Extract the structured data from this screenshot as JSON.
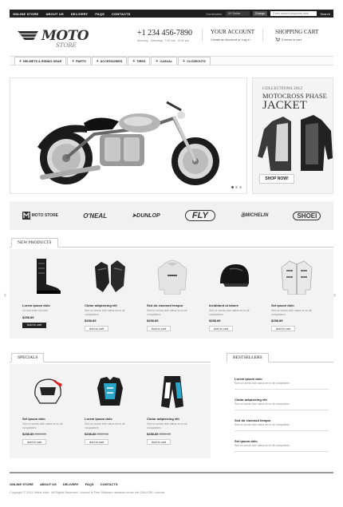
{
  "topbar": {
    "nav": [
      "ONLINE STORE",
      "ABOUT US",
      "DELIVERY",
      "FAQS",
      "CONTACTS"
    ],
    "currencies_label": "Currencies:",
    "currency_value": "US Dollar",
    "change_label": "Change",
    "search_placeholder": "Enter search keywords here",
    "search_label": "Search"
  },
  "header": {
    "logo_main": "MOTO",
    "logo_sub": "STORE",
    "phone": "+1 234 456-7890",
    "hours": "Monday - Saturday: 7:00 am - 6:00 pm",
    "account_title": "YOUR ACCOUNT",
    "account_create": "Create an Account",
    "account_or": "or",
    "account_login": "Log in",
    "cart_title": "SHOPPING CART",
    "cart_status": "0 items in cart"
  },
  "menu": [
    "HELMETS & RIDING GEAR",
    "PARTS",
    "ACCESSORIES",
    "TIRES",
    "CASUAL",
    "CLOSEOUTS"
  ],
  "promo": {
    "collection": "COLLECTIONS 2012",
    "title": "MOTOCROSS PHASE",
    "subtitle": "JACKET",
    "button": "SHOP NOW!"
  },
  "brands": [
    "MOTO STORE",
    "O'NEAL",
    "DUNLOP",
    "FLY",
    "MICHELIN",
    "SHOEI"
  ],
  "new_products": {
    "title": "NEW PRODUCTS",
    "items": [
      {
        "name": "Lorem ipsum dolo",
        "desc": "Ut wisi enim ad mini",
        "price": "$258.89",
        "button": "Add to cart",
        "dark": true,
        "icon": "boots-icon"
      },
      {
        "name": "Clotur adipisicing elit",
        "desc": "Sed ut omnis iste natus error sit voluptatem",
        "price": "$258.89",
        "button": "Add to cart",
        "dark": false,
        "icon": "gloves-icon"
      },
      {
        "name": "Sed do eiusmod tempor",
        "desc": "Sed ut omnis iste natus error sit voluptatem",
        "price": "$258.89",
        "button": "Add to cart",
        "dark": false,
        "icon": "hoodie-icon"
      },
      {
        "name": "Incididunt ut labore",
        "desc": "Sed ut omnis iste natus error sit voluptatem",
        "price": "$258.89",
        "button": "Add to cart",
        "dark": false,
        "icon": "helmet-icon"
      },
      {
        "name": "Set ipsum dolo",
        "desc": "Sed ut omnis iste natus error sit voluptatem",
        "price": "$258.89",
        "button": "Add to cart",
        "dark": false,
        "icon": "jacket-icon"
      }
    ]
  },
  "specials": {
    "title": "SPECIALS",
    "items": [
      {
        "name": "Set ipsum dolo",
        "desc": "Sed ut omnis iste natus error sit voluptatem",
        "price": "$258.89",
        "old_price": "$335.88",
        "button": "Add to cart",
        "icon": "mx-helmet-icon"
      },
      {
        "name": "Lorem ipsum dolo",
        "desc": "Sed ut omnis iste natus error sit voluptatem",
        "price": "$258.89",
        "old_price": "$335.88",
        "button": "Add to cart",
        "icon": "chest-protector-icon"
      },
      {
        "name": "Clotur adipisicing elit",
        "desc": "Sed ut omnis iste natus error sit voluptatem",
        "price": "$258.89",
        "old_price": "$335.88",
        "button": "Add to cart",
        "icon": "mx-pants-icon"
      }
    ]
  },
  "bestsellers": {
    "title": "BESTSELLERS",
    "items": [
      {
        "name": "Lorem ipsum dolo",
        "desc": "Sed ut omnis iste natus error sit voluptatem"
      },
      {
        "name": "Clotur adipisicing elit",
        "desc": "Sed ut omnis iste natus error sit voluptatem"
      },
      {
        "name": "Sed do eiusmod tempor",
        "desc": "Sed ut omnis iste natus error sit voluptatem"
      },
      {
        "name": "Set ipsum dolo",
        "desc": "Sed ut omnis iste natus error sit voluptatem"
      }
    ]
  },
  "footer": {
    "nav": [
      "ONLINE STORE",
      "ABOUT US",
      "DELIVERY",
      "FAQS",
      "CONTACTS"
    ],
    "copyright": "Copyright © 2011 Vellux Mart . All Rights Reserved. Joomla! is Free Software released under the GNU/GPL License."
  }
}
